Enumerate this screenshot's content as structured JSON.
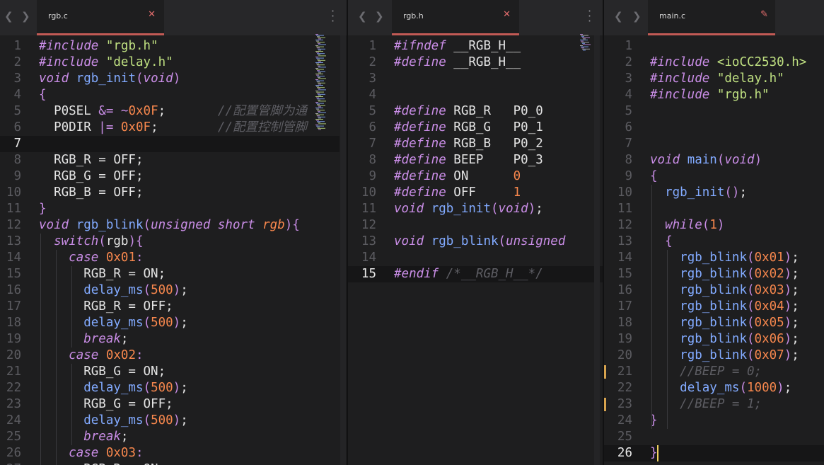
{
  "panes": [
    {
      "tab": "rgb.c",
      "tab_action": "close",
      "current_line": 7,
      "lines": [
        [
          [
            "pp",
            "#include"
          ],
          [
            "id",
            " "
          ],
          [
            "str",
            "\"rgb.h\""
          ]
        ],
        [
          [
            "pp",
            "#include"
          ],
          [
            "id",
            " "
          ],
          [
            "str",
            "\"delay.h\""
          ]
        ],
        [
          [
            "kw",
            "void"
          ],
          [
            "id",
            " "
          ],
          [
            "fn",
            "rgb_init"
          ],
          [
            "op",
            "("
          ],
          [
            "kw",
            "void"
          ],
          [
            "op",
            ")"
          ]
        ],
        [
          [
            "op",
            "{"
          ]
        ],
        [
          [
            "id",
            "  P0SEL "
          ],
          [
            "op",
            "&="
          ],
          [
            "id",
            " "
          ],
          [
            "op",
            "~"
          ],
          [
            "num2",
            "0x0F"
          ],
          [
            "id",
            ";       "
          ],
          [
            "cm",
            "//配置管脚为通"
          ]
        ],
        [
          [
            "id",
            "  P0DIR "
          ],
          [
            "op",
            "|="
          ],
          [
            "id",
            " "
          ],
          [
            "num2",
            "0x0F"
          ],
          [
            "id",
            ";        "
          ],
          [
            "cm",
            "//配置控制管脚"
          ]
        ],
        [
          [
            "id",
            ""
          ]
        ],
        [
          [
            "id",
            "  RGB_R = OFF;"
          ]
        ],
        [
          [
            "id",
            "  RGB_G = OFF;"
          ]
        ],
        [
          [
            "id",
            "  RGB_B = OFF;"
          ]
        ],
        [
          [
            "op",
            "}"
          ]
        ],
        [
          [
            "kw",
            "void"
          ],
          [
            "id",
            " "
          ],
          [
            "fn",
            "rgb_blink"
          ],
          [
            "op",
            "("
          ],
          [
            "kw",
            "unsigned short"
          ],
          [
            "id",
            " "
          ],
          [
            "param",
            "rgb"
          ],
          [
            "op",
            "){"
          ]
        ],
        [
          [
            "id",
            "  "
          ],
          [
            "kw",
            "switch"
          ],
          [
            "op",
            "("
          ],
          [
            "id",
            "rgb"
          ],
          [
            "op",
            "){"
          ]
        ],
        [
          [
            "id",
            "    "
          ],
          [
            "kw",
            "case"
          ],
          [
            "id",
            " "
          ],
          [
            "num2",
            "0x01"
          ],
          [
            "op",
            ":"
          ]
        ],
        [
          [
            "id",
            "      RGB_R = ON;"
          ]
        ],
        [
          [
            "id",
            "      "
          ],
          [
            "fn",
            "delay_ms"
          ],
          [
            "op",
            "("
          ],
          [
            "num2",
            "500"
          ],
          [
            "op",
            ")"
          ],
          [
            "id",
            ";"
          ]
        ],
        [
          [
            "id",
            "      RGB_R = OFF;"
          ]
        ],
        [
          [
            "id",
            "      "
          ],
          [
            "fn",
            "delay_ms"
          ],
          [
            "op",
            "("
          ],
          [
            "num2",
            "500"
          ],
          [
            "op",
            ")"
          ],
          [
            "id",
            ";"
          ]
        ],
        [
          [
            "id",
            "      "
          ],
          [
            "kw",
            "break"
          ],
          [
            "id",
            ";"
          ]
        ],
        [
          [
            "id",
            "    "
          ],
          [
            "kw",
            "case"
          ],
          [
            "id",
            " "
          ],
          [
            "num2",
            "0x02"
          ],
          [
            "op",
            ":"
          ]
        ],
        [
          [
            "id",
            "      RGB_G = ON;"
          ]
        ],
        [
          [
            "id",
            "      "
          ],
          [
            "fn",
            "delay_ms"
          ],
          [
            "op",
            "("
          ],
          [
            "num2",
            "500"
          ],
          [
            "op",
            ")"
          ],
          [
            "id",
            ";"
          ]
        ],
        [
          [
            "id",
            "      RGB_G = OFF;"
          ]
        ],
        [
          [
            "id",
            "      "
          ],
          [
            "fn",
            "delay_ms"
          ],
          [
            "op",
            "("
          ],
          [
            "num2",
            "500"
          ],
          [
            "op",
            ")"
          ],
          [
            "id",
            ";"
          ]
        ],
        [
          [
            "id",
            "      "
          ],
          [
            "kw",
            "break"
          ],
          [
            "id",
            ";"
          ]
        ],
        [
          [
            "id",
            "    "
          ],
          [
            "kw",
            "case"
          ],
          [
            "id",
            " "
          ],
          [
            "num2",
            "0x03"
          ],
          [
            "op",
            ":"
          ]
        ],
        [
          [
            "id",
            "      RGB_R = ON;"
          ]
        ]
      ]
    },
    {
      "tab": "rgb.h",
      "tab_action": "close",
      "current_line": 15,
      "lines": [
        [
          [
            "pp",
            "#ifndef"
          ],
          [
            "id",
            " __RGB_H__"
          ]
        ],
        [
          [
            "pp",
            "#define"
          ],
          [
            "id",
            " __RGB_H__"
          ]
        ],
        [
          [
            "id",
            ""
          ]
        ],
        [
          [
            "id",
            ""
          ]
        ],
        [
          [
            "pp",
            "#define"
          ],
          [
            "id",
            " RGB_R   P0_0"
          ]
        ],
        [
          [
            "pp",
            "#define"
          ],
          [
            "id",
            " RGB_G   P0_1"
          ]
        ],
        [
          [
            "pp",
            "#define"
          ],
          [
            "id",
            " RGB_B   P0_2"
          ]
        ],
        [
          [
            "pp",
            "#define"
          ],
          [
            "id",
            " BEEP    P0_3"
          ]
        ],
        [
          [
            "pp",
            "#define"
          ],
          [
            "id",
            " ON      "
          ],
          [
            "num2",
            "0"
          ]
        ],
        [
          [
            "pp",
            "#define"
          ],
          [
            "id",
            " OFF     "
          ],
          [
            "num2",
            "1"
          ]
        ],
        [
          [
            "kw",
            "void"
          ],
          [
            "id",
            " "
          ],
          [
            "fn",
            "rgb_init"
          ],
          [
            "op",
            "("
          ],
          [
            "kw",
            "void"
          ],
          [
            "op",
            ")"
          ],
          [
            "id",
            ";"
          ]
        ],
        [
          [
            "id",
            ""
          ]
        ],
        [
          [
            "kw",
            "void"
          ],
          [
            "id",
            " "
          ],
          [
            "fn",
            "rgb_blink"
          ],
          [
            "op",
            "("
          ],
          [
            "kw",
            "unsigned"
          ]
        ],
        [
          [
            "id",
            ""
          ]
        ],
        [
          [
            "pp",
            "#endif"
          ],
          [
            "id",
            " "
          ],
          [
            "cm",
            "/*__RGB_H__*/"
          ]
        ]
      ]
    },
    {
      "tab": "main.c",
      "tab_action": "edit",
      "current_line": 26,
      "modified_lines": [
        21,
        23
      ],
      "lines": [
        [
          [
            "id",
            ""
          ]
        ],
        [
          [
            "pp",
            "#include"
          ],
          [
            "id",
            " "
          ],
          [
            "ang",
            "<ioCC2530.h>"
          ]
        ],
        [
          [
            "pp",
            "#include"
          ],
          [
            "id",
            " "
          ],
          [
            "str",
            "\"delay.h\""
          ]
        ],
        [
          [
            "pp",
            "#include"
          ],
          [
            "id",
            " "
          ],
          [
            "str",
            "\"rgb.h\""
          ]
        ],
        [
          [
            "id",
            ""
          ]
        ],
        [
          [
            "id",
            ""
          ]
        ],
        [
          [
            "id",
            ""
          ]
        ],
        [
          [
            "kw",
            "void"
          ],
          [
            "id",
            " "
          ],
          [
            "fn",
            "main"
          ],
          [
            "op",
            "("
          ],
          [
            "kw",
            "void"
          ],
          [
            "op",
            ")"
          ]
        ],
        [
          [
            "op",
            "{"
          ]
        ],
        [
          [
            "id",
            "  "
          ],
          [
            "fn",
            "rgb_init"
          ],
          [
            "op",
            "()"
          ],
          [
            "id",
            ";"
          ]
        ],
        [
          [
            "id",
            ""
          ]
        ],
        [
          [
            "id",
            "  "
          ],
          [
            "kw",
            "while"
          ],
          [
            "op",
            "("
          ],
          [
            "num2",
            "1"
          ],
          [
            "op",
            ")"
          ]
        ],
        [
          [
            "id",
            "  "
          ],
          [
            "op",
            "{"
          ]
        ],
        [
          [
            "id",
            "    "
          ],
          [
            "fn",
            "rgb_blink"
          ],
          [
            "op",
            "("
          ],
          [
            "num2",
            "0x01"
          ],
          [
            "op",
            ")"
          ],
          [
            "id",
            ";"
          ]
        ],
        [
          [
            "id",
            "    "
          ],
          [
            "fn",
            "rgb_blink"
          ],
          [
            "op",
            "("
          ],
          [
            "num2",
            "0x02"
          ],
          [
            "op",
            ")"
          ],
          [
            "id",
            ";"
          ]
        ],
        [
          [
            "id",
            "    "
          ],
          [
            "fn",
            "rgb_blink"
          ],
          [
            "op",
            "("
          ],
          [
            "num2",
            "0x03"
          ],
          [
            "op",
            ")"
          ],
          [
            "id",
            ";"
          ]
        ],
        [
          [
            "id",
            "    "
          ],
          [
            "fn",
            "rgb_blink"
          ],
          [
            "op",
            "("
          ],
          [
            "num2",
            "0x04"
          ],
          [
            "op",
            ")"
          ],
          [
            "id",
            ";"
          ]
        ],
        [
          [
            "id",
            "    "
          ],
          [
            "fn",
            "rgb_blink"
          ],
          [
            "op",
            "("
          ],
          [
            "num2",
            "0x05"
          ],
          [
            "op",
            ")"
          ],
          [
            "id",
            ";"
          ]
        ],
        [
          [
            "id",
            "    "
          ],
          [
            "fn",
            "rgb_blink"
          ],
          [
            "op",
            "("
          ],
          [
            "num2",
            "0x06"
          ],
          [
            "op",
            ")"
          ],
          [
            "id",
            ";"
          ]
        ],
        [
          [
            "id",
            "    "
          ],
          [
            "fn",
            "rgb_blink"
          ],
          [
            "op",
            "("
          ],
          [
            "num2",
            "0x07"
          ],
          [
            "op",
            ")"
          ],
          [
            "id",
            ";"
          ]
        ],
        [
          [
            "id",
            "    "
          ],
          [
            "cm",
            "//BEEP = 0;"
          ]
        ],
        [
          [
            "id",
            "    "
          ],
          [
            "fn",
            "delay_ms"
          ],
          [
            "op",
            "("
          ],
          [
            "num2",
            "1000"
          ],
          [
            "op",
            ")"
          ],
          [
            "id",
            ";"
          ]
        ],
        [
          [
            "id",
            "    "
          ],
          [
            "cm",
            "//BEEP = 1;"
          ]
        ],
        [
          [
            "op",
            "}"
          ]
        ],
        [
          [
            "id",
            ""
          ]
        ],
        [
          [
            "op",
            "}"
          ]
        ]
      ]
    }
  ],
  "icons": {
    "back": "chevron-left-icon",
    "forward": "chevron-right-icon",
    "close": "close-icon",
    "edit": "pencil-icon",
    "more": "more-vertical-icon"
  },
  "colors": {
    "background": "#1e1e1f",
    "keyword": "#c98de6",
    "string": "#bfe081",
    "number": "#f7874d",
    "function": "#82aaff",
    "comment": "#5d5d63",
    "tab_underline": "#c25a55",
    "modified_marker": "#d7a34e"
  }
}
